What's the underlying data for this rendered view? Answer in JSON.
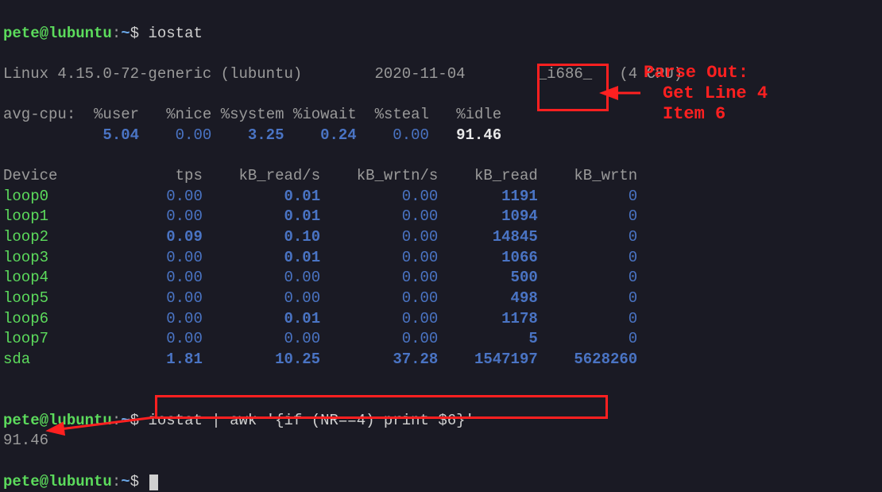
{
  "prompt": {
    "user": "pete",
    "at": "@",
    "host": "lubuntu",
    "colon": ":",
    "path": "~",
    "dollar": "$"
  },
  "cmd1": "iostat",
  "sysline": {
    "kernel": "Linux 4.15.0-72-generic (lubuntu)",
    "date": "2020-11-04",
    "arch": "_i686_",
    "cpu": "(4 CPU)"
  },
  "cpu_header": {
    "label": "avg-cpu:",
    "user": "%user",
    "nice": "%nice",
    "system": "%system",
    "iowait": "%iowait",
    "steal": "%steal",
    "idle": "%idle"
  },
  "cpu_values": {
    "user": "5.04",
    "nice": "0.00",
    "system": "3.25",
    "iowait": "0.24",
    "steal": "0.00",
    "idle": "91.46"
  },
  "dev_header": {
    "device": "Device",
    "tps": "tps",
    "rds": "kB_read/s",
    "wrs": "kB_wrtn/s",
    "rd": "kB_read",
    "wr": "kB_wrtn"
  },
  "devices": [
    {
      "name": "loop0",
      "tps": "0.00",
      "rds": "0.01",
      "wrs": "0.00",
      "rd": "1191",
      "wr": "0"
    },
    {
      "name": "loop1",
      "tps": "0.00",
      "rds": "0.01",
      "wrs": "0.00",
      "rd": "1094",
      "wr": "0"
    },
    {
      "name": "loop2",
      "tps": "0.09",
      "rds": "0.10",
      "wrs": "0.00",
      "rd": "14845",
      "wr": "0"
    },
    {
      "name": "loop3",
      "tps": "0.00",
      "rds": "0.01",
      "wrs": "0.00",
      "rd": "1066",
      "wr": "0"
    },
    {
      "name": "loop4",
      "tps": "0.00",
      "rds": "0.00",
      "wrs": "0.00",
      "rd": "500",
      "wr": "0"
    },
    {
      "name": "loop5",
      "tps": "0.00",
      "rds": "0.00",
      "wrs": "0.00",
      "rd": "498",
      "wr": "0"
    },
    {
      "name": "loop6",
      "tps": "0.00",
      "rds": "0.01",
      "wrs": "0.00",
      "rd": "1178",
      "wr": "0"
    },
    {
      "name": "loop7",
      "tps": "0.00",
      "rds": "0.00",
      "wrs": "0.00",
      "rd": "5",
      "wr": "0"
    },
    {
      "name": "sda",
      "tps": "1.81",
      "rds": "10.25",
      "wrs": "37.28",
      "rd": "1547197",
      "wr": "5628260"
    }
  ],
  "cmd2": "iostat | awk '{if (NR==4) print $6}'",
  "result2": "91.46",
  "annotation": {
    "title": "Parse Out:",
    "l1": "Get Line 4",
    "l2": "Item 6"
  }
}
